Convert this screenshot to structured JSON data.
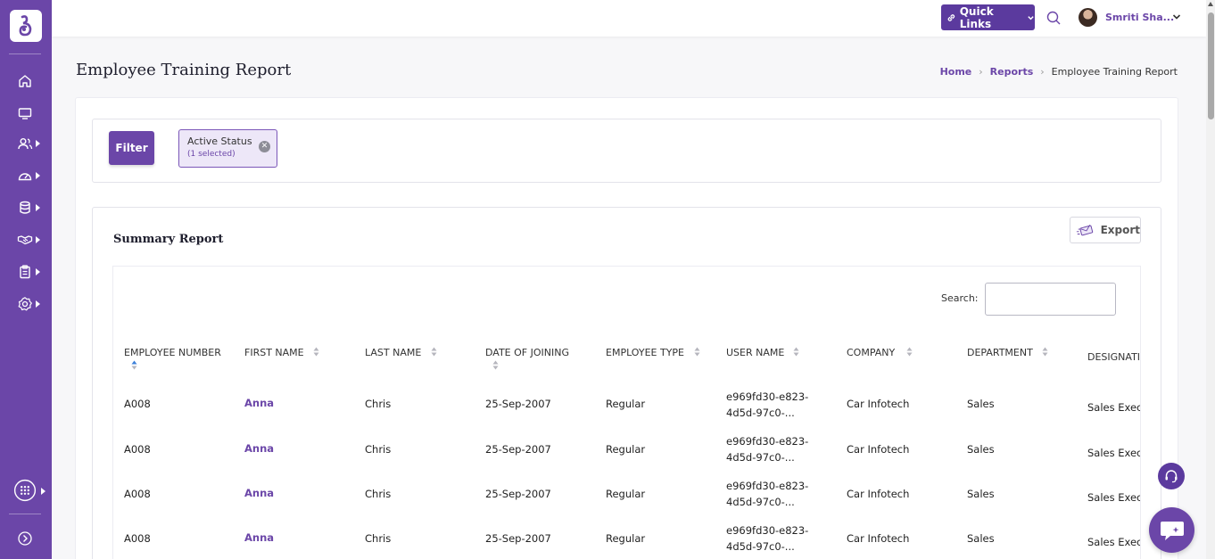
{
  "header": {
    "quick_links_label": "Quick Links",
    "user_name": "Smriti Sha..."
  },
  "page": {
    "title": "Employee Training Report",
    "breadcrumb": [
      "Home",
      "Reports",
      "Employee Training Report"
    ]
  },
  "filter": {
    "button_label": "Filter",
    "chip_title": "Active Status",
    "chip_subtitle": "(1 selected)"
  },
  "summary": {
    "title": "Summary Report",
    "export_label": "Export",
    "search_label": "Search:",
    "search_value": ""
  },
  "table": {
    "columns": [
      "EMPLOYEE NUMBER",
      "FIRST NAME",
      "LAST NAME",
      "DATE OF JOINING",
      "EMPLOYEE TYPE",
      "USER NAME",
      "COMPANY",
      "DEPARTMENT",
      "DESIGNATI"
    ],
    "rows": [
      [
        "A008",
        "Anna",
        "Chris",
        "25-Sep-2007",
        "Regular",
        "e969fd30-e823-4d5d-97c0-...",
        "Car Infotech",
        "Sales",
        "Sales Exec"
      ],
      [
        "A008",
        "Anna",
        "Chris",
        "25-Sep-2007",
        "Regular",
        "e969fd30-e823-4d5d-97c0-...",
        "Car Infotech",
        "Sales",
        "Sales Exec"
      ],
      [
        "A008",
        "Anna",
        "Chris",
        "25-Sep-2007",
        "Regular",
        "e969fd30-e823-4d5d-97c0-...",
        "Car Infotech",
        "Sales",
        "Sales Exec"
      ],
      [
        "A008",
        "Anna",
        "Chris",
        "25-Sep-2007",
        "Regular",
        "e969fd30-e823-4d5d-97c0-...",
        "Car Infotech",
        "Sales",
        "Sales Exec"
      ]
    ]
  },
  "sidebar": {
    "icons": [
      "home-icon",
      "monitor-icon",
      "users-icon",
      "dashboard-icon",
      "database-icon",
      "handshake-icon",
      "clipboard-icon",
      "settings-icon",
      "apps-grid-icon",
      "collapse-icon"
    ]
  },
  "colors": {
    "brand": "#6b46a8",
    "brand_dark": "#5b3a9e",
    "chip_bg": "#ede7f8"
  }
}
